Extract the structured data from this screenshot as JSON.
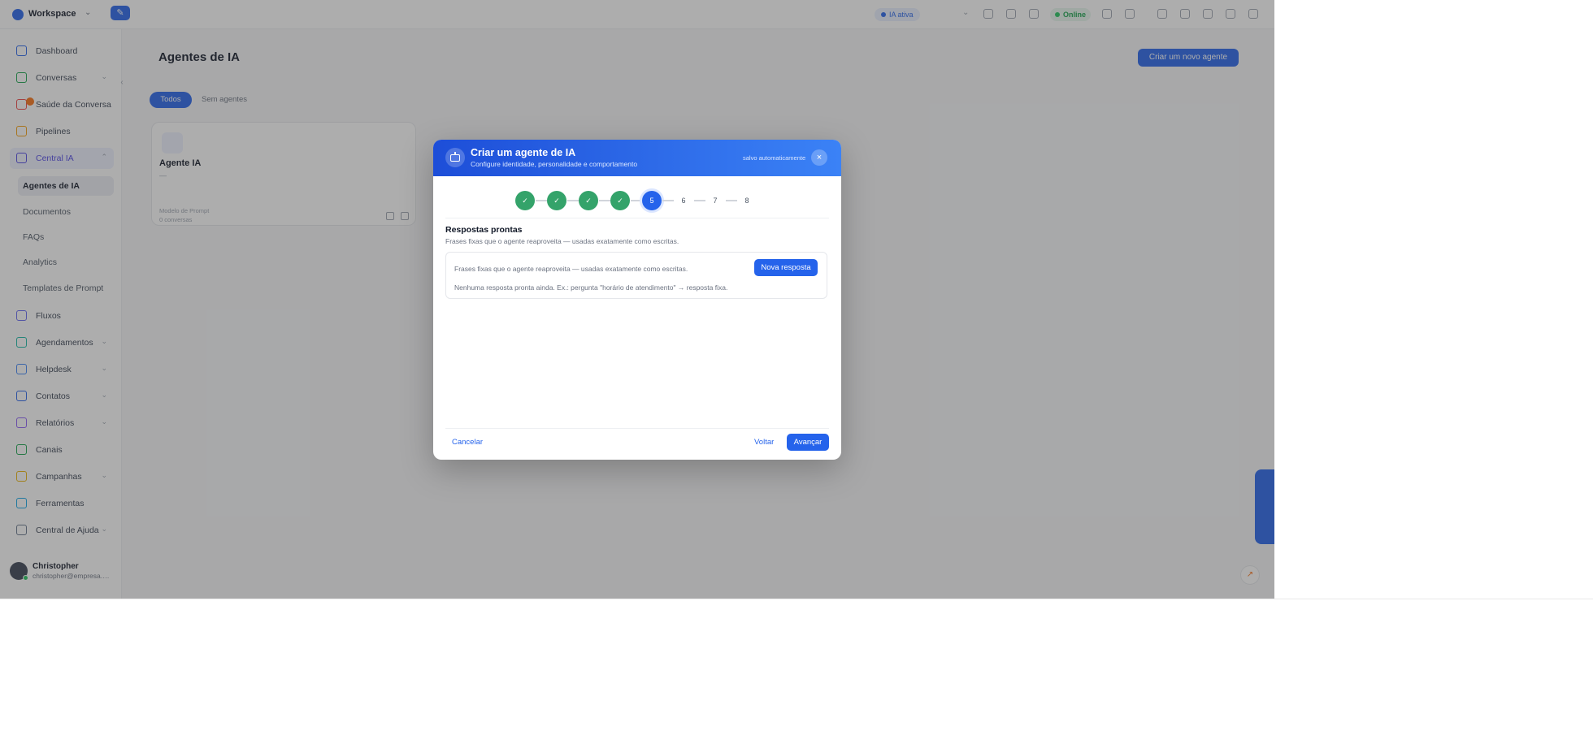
{
  "topbar": {
    "workspace_name": "Workspace",
    "ai_status": "IA ativa",
    "online_label": "Online"
  },
  "sidebar": {
    "items": [
      {
        "label": "Dashboard",
        "icon": "dashboard-icon"
      },
      {
        "label": "Conversas",
        "icon": "chat-icon"
      },
      {
        "label": "Saúde da Conversa",
        "icon": "heart-icon"
      },
      {
        "label": "Pipelines",
        "icon": "pipeline-icon"
      },
      {
        "label": "Central IA",
        "icon": "robot-icon"
      },
      {
        "label": "Fluxos",
        "icon": "flow-icon"
      },
      {
        "label": "Agendamentos",
        "icon": "calendar-icon"
      },
      {
        "label": "Helpdesk",
        "icon": "helpdesk-icon"
      },
      {
        "label": "Contatos",
        "icon": "contacts-icon"
      },
      {
        "label": "Relatórios",
        "icon": "reports-icon"
      },
      {
        "label": "Canais",
        "icon": "channels-icon"
      },
      {
        "label": "Campanhas",
        "icon": "campaigns-icon"
      },
      {
        "label": "Ferramentas",
        "icon": "tools-icon"
      },
      {
        "label": "Central de Ajuda",
        "icon": "help-icon"
      }
    ],
    "sub_items": [
      {
        "label": "Agentes de IA"
      },
      {
        "label": "Documentos"
      },
      {
        "label": "FAQs"
      },
      {
        "label": "Analytics"
      },
      {
        "label": "Templates de Prompt"
      }
    ],
    "user": {
      "name": "Christopher",
      "email": "christopher@empresa.com"
    }
  },
  "main": {
    "title": "Agentes de IA",
    "create_button": "Criar um novo agente",
    "tabs": [
      {
        "label": "Todos"
      },
      {
        "label": "Sem agentes"
      }
    ],
    "card": {
      "name": "Agente IA",
      "dash": "—",
      "meta1": "Modelo de Prompt",
      "meta2": "0 conversas"
    }
  },
  "modal": {
    "title": "Criar um agente de IA",
    "subtitle": "Configure identidade, personalidade e comportamento",
    "saved": "salvo automaticamente",
    "close": "×",
    "steps": [
      "✓",
      "✓",
      "✓",
      "✓",
      "5",
      "6",
      "7",
      "8"
    ],
    "current_step": 5,
    "section_title": "Respostas prontas",
    "section_desc": "Frases fixas que o agente reaproveita — usadas exatamente como escritas.",
    "panel_desc": "Frases fixas que o agente reaproveita — usadas exatamente como escritas.",
    "new_button": "Nova resposta",
    "empty_text": "Nenhuma resposta pronta ainda. Ex.: pergunta \"horário de atendimento\" → resposta fixa.",
    "cancel": "Cancelar",
    "back": "Voltar",
    "next": "Avançar"
  },
  "colors": {
    "accent": "#2563eb",
    "step_done": "#34a36a",
    "online": "#16a34a"
  }
}
